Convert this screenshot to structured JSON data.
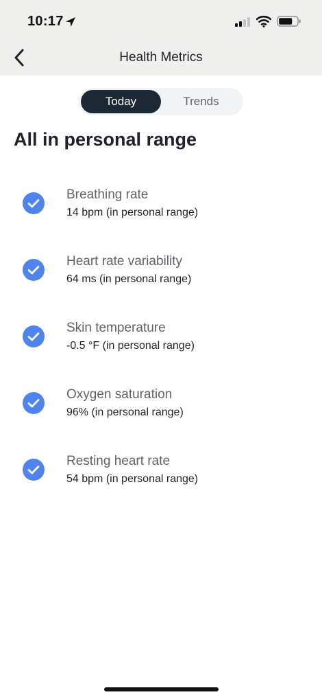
{
  "status_bar": {
    "time": "10:17",
    "icons": [
      "location-arrow-icon",
      "cellular-signal-icon",
      "wifi-icon",
      "battery-icon"
    ]
  },
  "nav": {
    "title": "Health Metrics",
    "back_icon": "chevron-left-icon"
  },
  "tabs": [
    {
      "label": "Today",
      "selected": true
    },
    {
      "label": "Trends",
      "selected": false
    }
  ],
  "heading": "All in personal range",
  "metrics": [
    {
      "name": "Breathing rate",
      "value": "14 bpm (in personal range)",
      "icon": "checkmark-circle-icon"
    },
    {
      "name": "Heart rate variability",
      "value": "64 ms (in personal range)",
      "icon": "checkmark-circle-icon"
    },
    {
      "name": "Skin temperature",
      "value": "-0.5 °F (in personal range)",
      "icon": "checkmark-circle-icon"
    },
    {
      "name": "Oxygen saturation",
      "value": "96% (in personal range)",
      "icon": "checkmark-circle-icon"
    },
    {
      "name": "Resting heart rate",
      "value": "54 bpm (in personal range)",
      "icon": "checkmark-circle-icon"
    }
  ],
  "colors": {
    "header_background": "#efefed",
    "selected_tab": "#1c2833",
    "check_blue": "#4f83ee",
    "secondary_text": "#5f6368"
  }
}
